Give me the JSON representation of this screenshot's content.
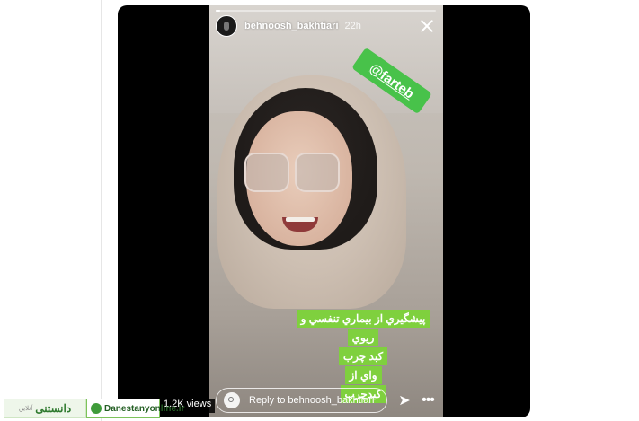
{
  "story": {
    "username": "behnoosh_bakhtiari",
    "time_ago": "22h",
    "progress": 0.02,
    "mention_sticker": "@farteb",
    "caption_lines": [
      "پيشگيري از بيماري تنفسي و",
      "ريوي",
      "کبد چرب",
      "واي از",
      "کبدچرب"
    ],
    "reply_placeholder": "Reply to behnoosh_bakhtiari",
    "icons": {
      "close": "close-icon",
      "camera": "camera-icon",
      "send": "send-icon",
      "more": "more-icon"
    },
    "sticker_color": "#48c24a",
    "caption_color": "#7fd03e"
  },
  "video": {
    "views": "1.2K views"
  },
  "watermarks": {
    "brand_fa": "دانستنی",
    "brand_fa_sub": "آنلاین",
    "site": "Danestanyonline.ir"
  }
}
